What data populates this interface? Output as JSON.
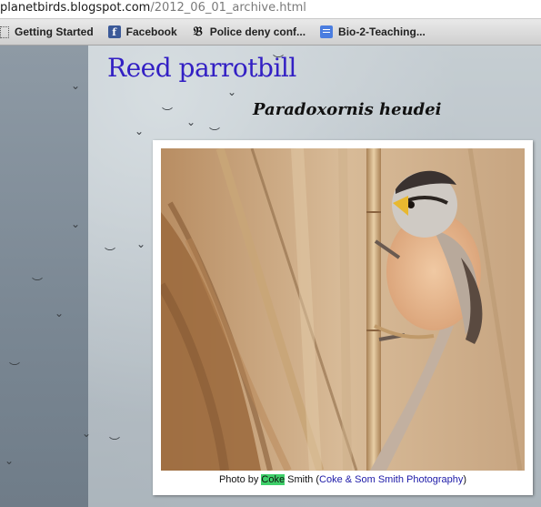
{
  "url": {
    "host": "planetbirds.blogspot.com",
    "path": "/2012_06_01_archive.html"
  },
  "bookmarks": [
    {
      "label": "Getting Started",
      "icon": "page-icon"
    },
    {
      "label": "Facebook",
      "icon": "facebook-icon"
    },
    {
      "label": "Police deny conf...",
      "icon": "newspaper-icon"
    },
    {
      "label": "Bio-2-Teaching...",
      "icon": "document-icon"
    }
  ],
  "post": {
    "title": "Reed parrotbill",
    "scientific_name": "Paradoxornis heudei",
    "caption": {
      "prefix": "Photo by ",
      "highlighted": "Coke",
      "middle": " Smith (",
      "link": "Coke & Som Smith Photography",
      "suffix": ")"
    }
  },
  "colors": {
    "title": "#3320c4",
    "highlight": "#3fd06a",
    "link": "#1d1aa8"
  }
}
